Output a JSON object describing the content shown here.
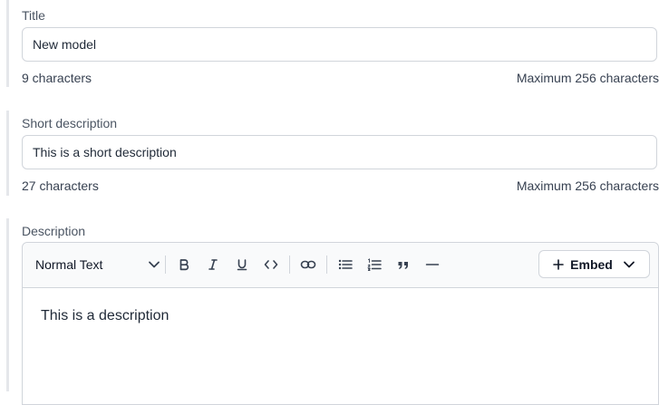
{
  "title_field": {
    "label": "Title",
    "value": "New model",
    "count": "9 characters",
    "max": "Maximum 256 characters"
  },
  "short_desc_field": {
    "label": "Short description",
    "value": "This is a short description",
    "count": "27 characters",
    "max": "Maximum 256 characters"
  },
  "description": {
    "label": "Description",
    "format_select": "Normal Text",
    "embed_label": "Embed",
    "content": "This is a description",
    "toolbar_icons": [
      "bold-icon",
      "italic-icon",
      "underline-icon",
      "code-icon",
      "link-icon",
      "bullet-list-icon",
      "numbered-list-icon",
      "quote-icon",
      "horizontal-rule-icon"
    ]
  }
}
